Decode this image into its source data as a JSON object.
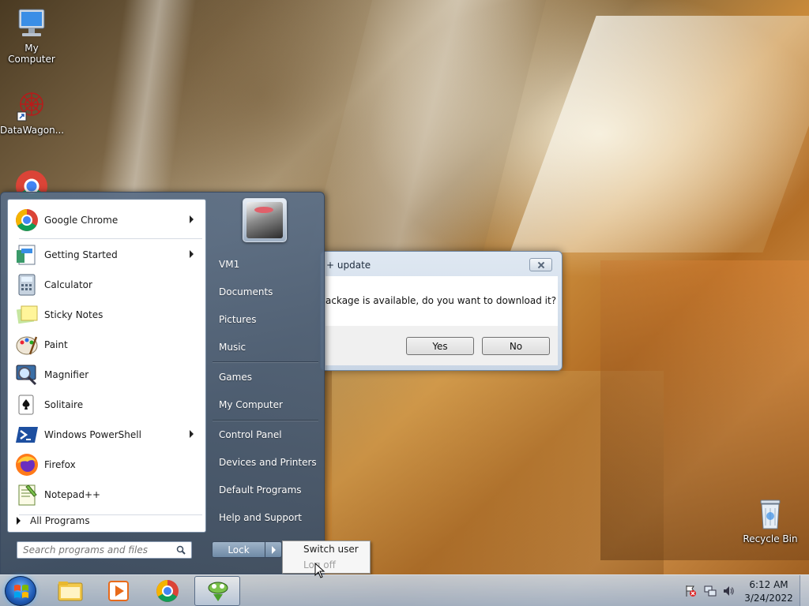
{
  "desktop": {
    "icons": [
      {
        "label": "My Computer",
        "icon": "computer-icon"
      },
      {
        "label": "DataWagon...",
        "icon": "datawagon-shortcut-icon"
      },
      {
        "label": "Recycle Bin",
        "icon": "recycle-bin-icon"
      }
    ]
  },
  "start_menu": {
    "programs": [
      {
        "label": "Google Chrome",
        "icon": "chrome-icon",
        "has_submenu": true
      },
      {
        "label": "Getting Started",
        "icon": "getting-started-icon",
        "has_submenu": true
      },
      {
        "label": "Calculator",
        "icon": "calculator-icon",
        "has_submenu": false
      },
      {
        "label": "Sticky Notes",
        "icon": "sticky-notes-icon",
        "has_submenu": false
      },
      {
        "label": "Paint",
        "icon": "paint-icon",
        "has_submenu": false
      },
      {
        "label": "Magnifier",
        "icon": "magnifier-icon",
        "has_submenu": false
      },
      {
        "label": "Solitaire",
        "icon": "solitaire-icon",
        "has_submenu": false
      },
      {
        "label": "Windows PowerShell",
        "icon": "powershell-icon",
        "has_submenu": true
      },
      {
        "label": "Firefox",
        "icon": "firefox-icon",
        "has_submenu": false
      },
      {
        "label": "Notepad++",
        "icon": "notepadpp-icon",
        "has_submenu": false
      }
    ],
    "all_programs": "All Programs",
    "search_placeholder": "Search programs and files",
    "right_items": [
      {
        "label": "VM1"
      },
      {
        "label": "Documents"
      },
      {
        "label": "Pictures"
      },
      {
        "label": "Music"
      },
      {
        "label": "Games"
      },
      {
        "label": "My Computer"
      },
      {
        "label": "Control Panel"
      },
      {
        "label": "Devices and Printers"
      },
      {
        "label": "Default Programs"
      },
      {
        "label": "Help and Support"
      }
    ],
    "lock_label": "Lock",
    "power_menu": [
      {
        "label": "Switch user",
        "enabled": true
      },
      {
        "label": "Log off",
        "enabled": false
      }
    ]
  },
  "dialog": {
    "title": "+ update",
    "message": "ackage is available, do you want to download it?",
    "yes": "Yes",
    "no": "No"
  },
  "taskbar": {
    "pinned": [
      "start-orb-icon",
      "explorer-icon",
      "media-player-icon",
      "chrome-icon",
      "notepadpp-icon"
    ],
    "time": "6:12 AM",
    "date": "3/24/2022",
    "tray_icons": [
      "action-center-icon",
      "network-icon",
      "volume-icon"
    ]
  },
  "colors": {
    "start_menu_bg": "#4f6580",
    "dialog_bg": "#dfe8f2",
    "taskbar_bg": "#b4c6dc"
  }
}
